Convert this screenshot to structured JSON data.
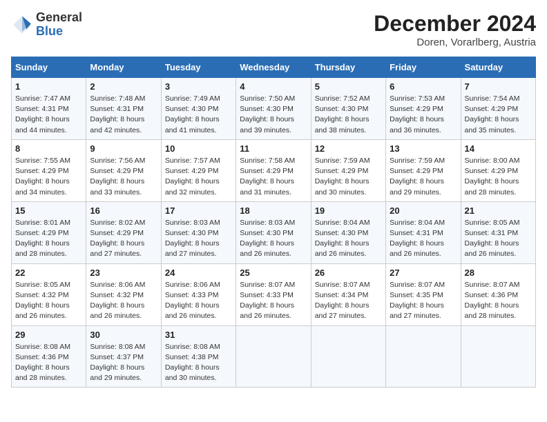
{
  "logo": {
    "general": "General",
    "blue": "Blue"
  },
  "header": {
    "month": "December 2024",
    "location": "Doren, Vorarlberg, Austria"
  },
  "days_of_week": [
    "Sunday",
    "Monday",
    "Tuesday",
    "Wednesday",
    "Thursday",
    "Friday",
    "Saturday"
  ],
  "weeks": [
    [
      {
        "day": "1",
        "sunrise": "7:47 AM",
        "sunset": "4:31 PM",
        "daylight": "8 hours and 44 minutes."
      },
      {
        "day": "2",
        "sunrise": "7:48 AM",
        "sunset": "4:31 PM",
        "daylight": "8 hours and 42 minutes."
      },
      {
        "day": "3",
        "sunrise": "7:49 AM",
        "sunset": "4:30 PM",
        "daylight": "8 hours and 41 minutes."
      },
      {
        "day": "4",
        "sunrise": "7:50 AM",
        "sunset": "4:30 PM",
        "daylight": "8 hours and 39 minutes."
      },
      {
        "day": "5",
        "sunrise": "7:52 AM",
        "sunset": "4:30 PM",
        "daylight": "8 hours and 38 minutes."
      },
      {
        "day": "6",
        "sunrise": "7:53 AM",
        "sunset": "4:29 PM",
        "daylight": "8 hours and 36 minutes."
      },
      {
        "day": "7",
        "sunrise": "7:54 AM",
        "sunset": "4:29 PM",
        "daylight": "8 hours and 35 minutes."
      }
    ],
    [
      {
        "day": "8",
        "sunrise": "7:55 AM",
        "sunset": "4:29 PM",
        "daylight": "8 hours and 34 minutes."
      },
      {
        "day": "9",
        "sunrise": "7:56 AM",
        "sunset": "4:29 PM",
        "daylight": "8 hours and 33 minutes."
      },
      {
        "day": "10",
        "sunrise": "7:57 AM",
        "sunset": "4:29 PM",
        "daylight": "8 hours and 32 minutes."
      },
      {
        "day": "11",
        "sunrise": "7:58 AM",
        "sunset": "4:29 PM",
        "daylight": "8 hours and 31 minutes."
      },
      {
        "day": "12",
        "sunrise": "7:59 AM",
        "sunset": "4:29 PM",
        "daylight": "8 hours and 30 minutes."
      },
      {
        "day": "13",
        "sunrise": "7:59 AM",
        "sunset": "4:29 PM",
        "daylight": "8 hours and 29 minutes."
      },
      {
        "day": "14",
        "sunrise": "8:00 AM",
        "sunset": "4:29 PM",
        "daylight": "8 hours and 28 minutes."
      }
    ],
    [
      {
        "day": "15",
        "sunrise": "8:01 AM",
        "sunset": "4:29 PM",
        "daylight": "8 hours and 28 minutes."
      },
      {
        "day": "16",
        "sunrise": "8:02 AM",
        "sunset": "4:29 PM",
        "daylight": "8 hours and 27 minutes."
      },
      {
        "day": "17",
        "sunrise": "8:03 AM",
        "sunset": "4:30 PM",
        "daylight": "8 hours and 27 minutes."
      },
      {
        "day": "18",
        "sunrise": "8:03 AM",
        "sunset": "4:30 PM",
        "daylight": "8 hours and 26 minutes."
      },
      {
        "day": "19",
        "sunrise": "8:04 AM",
        "sunset": "4:30 PM",
        "daylight": "8 hours and 26 minutes."
      },
      {
        "day": "20",
        "sunrise": "8:04 AM",
        "sunset": "4:31 PM",
        "daylight": "8 hours and 26 minutes."
      },
      {
        "day": "21",
        "sunrise": "8:05 AM",
        "sunset": "4:31 PM",
        "daylight": "8 hours and 26 minutes."
      }
    ],
    [
      {
        "day": "22",
        "sunrise": "8:05 AM",
        "sunset": "4:32 PM",
        "daylight": "8 hours and 26 minutes."
      },
      {
        "day": "23",
        "sunrise": "8:06 AM",
        "sunset": "4:32 PM",
        "daylight": "8 hours and 26 minutes."
      },
      {
        "day": "24",
        "sunrise": "8:06 AM",
        "sunset": "4:33 PM",
        "daylight": "8 hours and 26 minutes."
      },
      {
        "day": "25",
        "sunrise": "8:07 AM",
        "sunset": "4:33 PM",
        "daylight": "8 hours and 26 minutes."
      },
      {
        "day": "26",
        "sunrise": "8:07 AM",
        "sunset": "4:34 PM",
        "daylight": "8 hours and 27 minutes."
      },
      {
        "day": "27",
        "sunrise": "8:07 AM",
        "sunset": "4:35 PM",
        "daylight": "8 hours and 27 minutes."
      },
      {
        "day": "28",
        "sunrise": "8:07 AM",
        "sunset": "4:36 PM",
        "daylight": "8 hours and 28 minutes."
      }
    ],
    [
      {
        "day": "29",
        "sunrise": "8:08 AM",
        "sunset": "4:36 PM",
        "daylight": "8 hours and 28 minutes."
      },
      {
        "day": "30",
        "sunrise": "8:08 AM",
        "sunset": "4:37 PM",
        "daylight": "8 hours and 29 minutes."
      },
      {
        "day": "31",
        "sunrise": "8:08 AM",
        "sunset": "4:38 PM",
        "daylight": "8 hours and 30 minutes."
      },
      null,
      null,
      null,
      null
    ]
  ]
}
